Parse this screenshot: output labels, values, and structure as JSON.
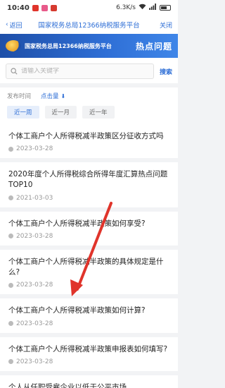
{
  "status": {
    "time": "10:40",
    "network": "6.3K/s",
    "icons": [
      "notification-badge-red",
      "notification-badge-pink",
      "notification-badge-red2"
    ]
  },
  "nav": {
    "back_label": "返回",
    "title": "国家税务总局12366纳税服务平台",
    "close_label": "关闭"
  },
  "banner": {
    "logo": "tax-emblem",
    "title": "国家税务总局12366纳税服务平台",
    "hot_label": "热点问题"
  },
  "search": {
    "placeholder": "请输入关键字",
    "button_label": "搜索"
  },
  "filters": {
    "sort": {
      "time_label": "发布时间",
      "hits_label": "点击量"
    },
    "ranges": [
      "近一周",
      "近一月",
      "近一年"
    ],
    "active_range": 0
  },
  "items": [
    {
      "title": "个体工商户个人所得税减半政策区分征收方式吗",
      "date": "2023-03-28"
    },
    {
      "title": "2020年度个人所得税综合所得年度汇算热点问题TOP10",
      "date": "2021-03-03"
    },
    {
      "title": "个体工商户个人所得税减半政策如何享受?",
      "date": "2023-03-28"
    },
    {
      "title": "个体工商户个人所得税减半政策的具体规定是什么?",
      "date": "2023-03-28"
    },
    {
      "title": "个体工商户个人所得税减半政策如何计算?",
      "date": "2023-03-28"
    },
    {
      "title": "个体工商户个人所得税减半政策申报表如何填写?",
      "date": "2023-03-28"
    },
    {
      "title": "个人从任职受雇企业以低于公平市场",
      "date": ""
    }
  ],
  "colors": {
    "accent": "#2f6fd6",
    "annotation_arrow": "#e0342b"
  }
}
